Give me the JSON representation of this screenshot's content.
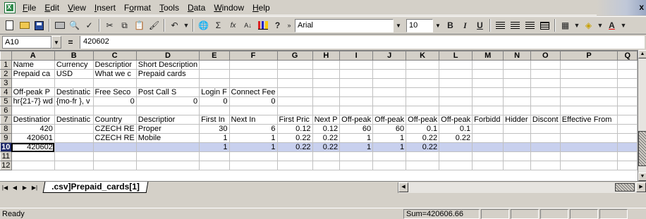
{
  "menus": [
    {
      "ul": "F",
      "rest": "ile"
    },
    {
      "ul": "E",
      "rest": "dit"
    },
    {
      "ul": "V",
      "rest": "iew"
    },
    {
      "ul": "I",
      "rest": "nsert"
    },
    {
      "ul": "",
      "pre": "F",
      "ul2": "o",
      "rest": "rmat"
    },
    {
      "ul": "T",
      "rest": "ools"
    },
    {
      "ul": "D",
      "rest": "ata"
    },
    {
      "ul": "W",
      "rest": "indow"
    },
    {
      "ul": "H",
      "rest": "elp"
    }
  ],
  "toolbar": {
    "font_name": "Arial",
    "font_size": "10",
    "bold_label": "B",
    "italic_label": "I",
    "underline_label": "U",
    "sum_label": "Σ",
    "fx_label": "fx",
    "sort_label": "A↓",
    "undo_label": "↶",
    "help_label": "?",
    "more_label": "»",
    "font_color_label": "A"
  },
  "formula_bar": {
    "cell_ref": "A10",
    "equals": "=",
    "value": "420602"
  },
  "grid": {
    "columns": [
      "A",
      "B",
      "C",
      "D",
      "E",
      "F",
      "G",
      "H",
      "I",
      "J",
      "K",
      "L",
      "M",
      "N",
      "O",
      "P",
      "Q"
    ],
    "rows": [
      {
        "n": "1",
        "cells": [
          "Name",
          "Currency",
          "Descriptior",
          "Short Description",
          "",
          "",
          "",
          "",
          "",
          "",
          "",
          "",
          "",
          "",
          "",
          "",
          ""
        ]
      },
      {
        "n": "2",
        "cells": [
          "Prepaid ca",
          "USD",
          "What we c",
          "Prepaid cards",
          "",
          "",
          "",
          "",
          "",
          "",
          "",
          "",
          "",
          "",
          "",
          "",
          ""
        ]
      },
      {
        "n": "3",
        "cells": [
          "",
          "",
          "",
          "",
          "",
          "",
          "",
          "",
          "",
          "",
          "",
          "",
          "",
          "",
          "",
          "",
          ""
        ]
      },
      {
        "n": "4",
        "cells": [
          "Off-peak P",
          "Destinatic",
          "Free Seco",
          "Post Call S",
          "Login F",
          "Connect Fee",
          "",
          "",
          "",
          "",
          "",
          "",
          "",
          "",
          "",
          "",
          ""
        ]
      },
      {
        "n": "5",
        "cells": [
          "hr{21-7} wd",
          "{mo-fr }, v",
          "0",
          "0",
          "0",
          "0",
          "",
          "",
          "",
          "",
          "",
          "",
          "",
          "",
          "",
          "",
          ""
        ]
      },
      {
        "n": "6",
        "cells": [
          "",
          "",
          "",
          "",
          "",
          "",
          "",
          "",
          "",
          "",
          "",
          "",
          "",
          "",
          "",
          "",
          ""
        ]
      },
      {
        "n": "7",
        "cells": [
          "Destinatior",
          "Destinatic",
          "Country",
          "Descriptior",
          "First In",
          "Next In",
          "First Pric",
          "Next P",
          "Off-peak",
          "Off-peak",
          "Off-peak",
          "Off-peak",
          "Forbidd",
          "Hidder",
          "Discont",
          "Effective From",
          ""
        ]
      },
      {
        "n": "8",
        "cells": [
          "420",
          "",
          "CZECH RE",
          "Proper",
          "30",
          "6",
          "0.12",
          "0.12",
          "60",
          "60",
          "0.1",
          "0.1",
          "",
          "",
          "",
          "",
          ""
        ]
      },
      {
        "n": "9",
        "cells": [
          "420601",
          "",
          "CZECH RE",
          "Mobile",
          "1",
          "1",
          "0.22",
          "0.22",
          "1",
          "1",
          "0.22",
          "0.22",
          "",
          "",
          "",
          "",
          ""
        ]
      },
      {
        "n": "10",
        "cells": [
          "420602",
          "",
          "",
          "",
          "1",
          "1",
          "0.22",
          "0.22",
          "1",
          "1",
          "0.22",
          "",
          "",
          "",
          "",
          "",
          ""
        ]
      },
      {
        "n": "11",
        "cells": [
          "",
          "",
          "",
          "",
          "",
          "",
          "",
          "",
          "",
          "",
          "",
          "",
          "",
          "",
          "",
          "",
          ""
        ]
      },
      {
        "n": "12",
        "cells": [
          "",
          "",
          "",
          "",
          "",
          "",
          "",
          "",
          "",
          "",
          "",
          "",
          "",
          "",
          "",
          "",
          ""
        ]
      }
    ]
  },
  "sheet_tab": {
    "label": ".csv]Prepaid_cards[1]"
  },
  "status": {
    "left": "Ready",
    "sum": "Sum=420606.66"
  }
}
